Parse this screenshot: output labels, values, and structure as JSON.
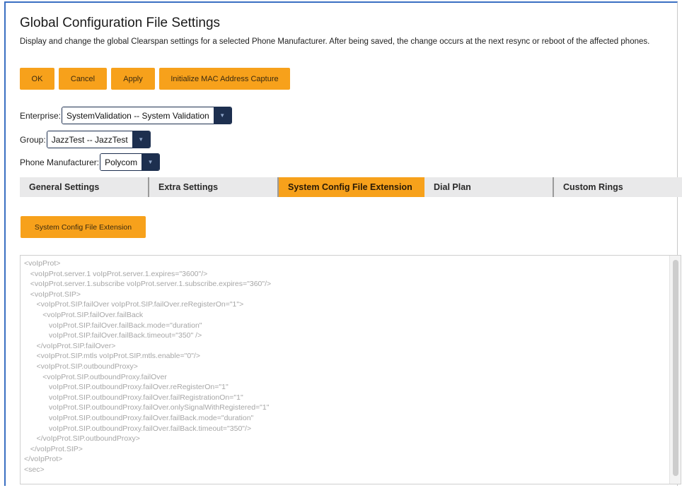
{
  "page": {
    "title": "Global Configuration File Settings",
    "description": "Display and change the global Clearspan settings for a selected Phone Manufacturer. After being saved, the change occurs at the next resync or reboot of the affected phones."
  },
  "buttons": {
    "ok": "OK",
    "cancel": "Cancel",
    "apply": "Apply",
    "init_mac": "Initialize MAC Address Capture"
  },
  "fields": {
    "enterprise": {
      "label": "Enterprise:",
      "value": "SystemValidation -- System Validation"
    },
    "group": {
      "label": "Group:",
      "value": "JazzTest -- JazzTest"
    },
    "manufacturer": {
      "label": "Phone Manufacturer:",
      "value": "Polycom"
    }
  },
  "tabs": [
    {
      "label": "General Settings",
      "active": false
    },
    {
      "label": "Extra Settings",
      "active": false
    },
    {
      "label": "System Config File Extension",
      "active": true
    },
    {
      "label": "Dial Plan",
      "active": false
    },
    {
      "label": "Custom Rings",
      "active": false
    }
  ],
  "section": {
    "button_label": "System Config File Extension"
  },
  "config_text": "<voIpProt>\n   <voIpProt.server.1 voIpProt.server.1.expires=\"3600\"/>\n   <voIpProt.server.1.subscribe voIpProt.server.1.subscribe.expires=\"360\"/>\n   <voIpProt.SIP>\n      <voIpProt.SIP.failOver voIpProt.SIP.failOver.reRegisterOn=\"1\">\n         <voIpProt.SIP.failOver.failBack\n            voIpProt.SIP.failOver.failBack.mode=\"duration\"\n            voIpProt.SIP.failOver.failBack.timeout=\"350\" />\n      </voIpProt.SIP.failOver>\n      <voIpProt.SIP.mtls voIpProt.SIP.mtls.enable=\"0\"/>\n      <voIpProt.SIP.outboundProxy>\n         <voIpProt.SIP.outboundProxy.failOver\n            voIpProt.SIP.outboundProxy.failOver.reRegisterOn=\"1\"\n            voIpProt.SIP.outboundProxy.failOver.failRegistrationOn=\"1\"\n            voIpProt.SIP.outboundProxy.failOver.onlySignalWithRegistered=\"1\"\n            voIpProt.SIP.outboundProxy.failOver.failBack.mode=\"duration\"\n            voIpProt.SIP.outboundProxy.failOver.failBack.timeout=\"350\"/>\n      </voIpProt.SIP.outboundProxy>\n   </voIpProt.SIP>\n</voIpProt>\n<sec>"
}
